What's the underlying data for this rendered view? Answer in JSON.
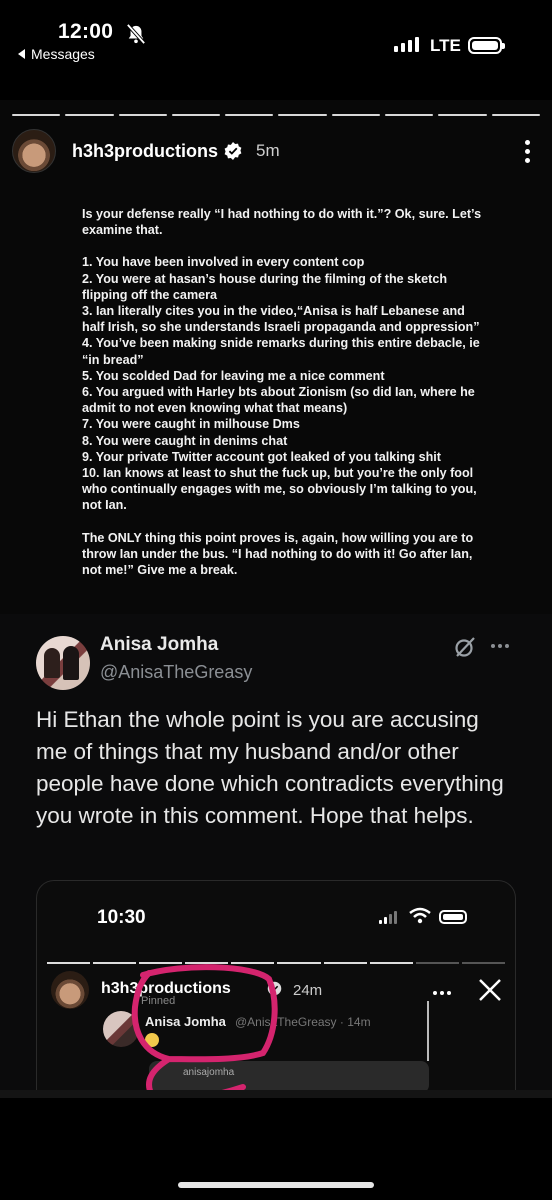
{
  "status_bar": {
    "time": "12:00",
    "back_label": "Messages",
    "network": "LTE"
  },
  "story": {
    "username": "h3h3productions",
    "age": "5m",
    "comment_lines": [
      "Is your defense really “I had nothing to do with it.”? Ok, sure. Let’s examine that.",
      "",
      "1. You have been involved in every content cop",
      "2. You were at hasan’s house during the filming of the sketch flipping off the camera",
      "3. Ian literally cites you in the video,“Anisa is half Lebanese and half Irish, so she understands Israeli propaganda and oppression”",
      "4. You’ve been making snide remarks during this entire debacle, ie “in bread”",
      "5. You scolded Dad for leaving me a nice comment",
      "6. You argued with Harley bts about Zionism (so did Ian, where he admit to not even knowing what that means)",
      "7. You were caught in milhouse Dms",
      "8. You were caught in denims chat",
      "9. Your private Twitter account got leaked of you talking shit",
      "10. Ian knows at least to shut the fuck up, but you’re the only fool who continually engages with me, so obviously I’m talking to you, not Ian.",
      "",
      "The ONLY thing this point proves is, again, how willing you are to throw Ian under the bus. “I had nothing to do with it! Go after Ian, not me!” Give me a break."
    ]
  },
  "tweet": {
    "name": "Anisa Jomha",
    "handle": "@AnisaTheGreasy",
    "body": "Hi Ethan the whole point is you are accusing me of things that my husband and/or other people have done which contradicts everything you wrote in this comment. Hope that helps."
  },
  "nested_screenshot": {
    "time": "10:30",
    "username": "h3h3productions",
    "age": "24m",
    "pinned_label": "Pinned",
    "comment_name": "Anisa Jomha",
    "comment_handle": "@AnisaTheGreasy · 14m",
    "card_label": "anisajomha"
  },
  "colors": {
    "background": "#000000",
    "tweet_text": "#e7e7e7",
    "handle_gray": "#8b8f94",
    "highlight_pink": "#d4246e",
    "verified_blue": "#ffffff"
  },
  "icons": {
    "bell": "bell-slash-icon",
    "verified": "verified-badge-icon",
    "grok": "grok-icon",
    "close": "close-icon"
  }
}
